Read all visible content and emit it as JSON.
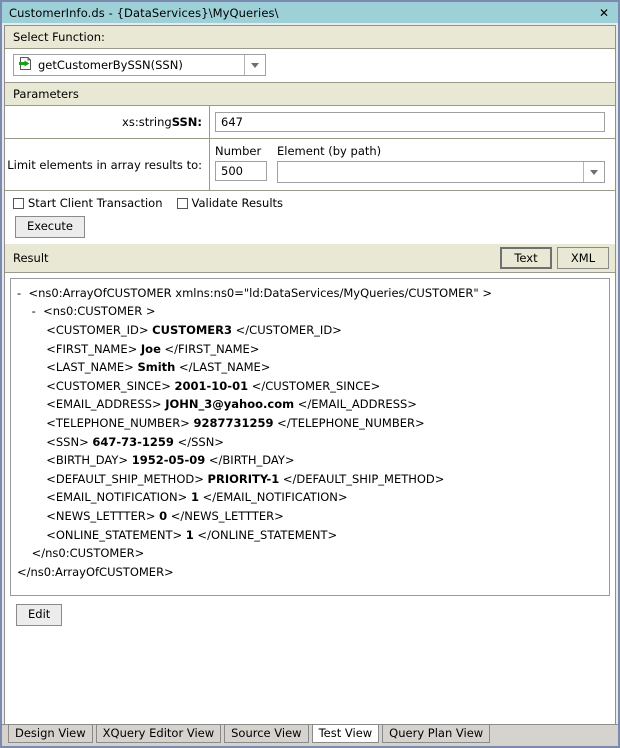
{
  "window": {
    "title": "CustomerInfo.ds - {DataServices}\\MyQueries\\",
    "close_label": "✕"
  },
  "select_function": {
    "header": "Select Function:",
    "selected": "getCustomerBySSN(SSN)",
    "icon": "function-document-arrow-icon"
  },
  "parameters": {
    "header": "Parameters",
    "ssn": {
      "type_label": "xs:string ",
      "name_label": "SSN:",
      "value": "647"
    },
    "limit": {
      "label": "Limit elements in array results to:",
      "number_header": "Number",
      "element_header": "Element (by path)",
      "number_value": "500",
      "element_value": ""
    }
  },
  "options": {
    "start_client_transaction": "Start Client Transaction",
    "validate_results": "Validate Results",
    "start_client_transaction_checked": false,
    "validate_results_checked": false
  },
  "actions": {
    "execute": "Execute",
    "edit": "Edit"
  },
  "result": {
    "header": "Result",
    "view_text": "Text",
    "view_xml": "XML",
    "active_view": "Text",
    "lines": [
      {
        "indent": 0,
        "marker": "-",
        "pre": "<ns0:ArrayOfCUSTOMER xmlns:ns0=\"ld:DataServices/MyQueries/CUSTOMER\" >",
        "value": "",
        "post": ""
      },
      {
        "indent": 1,
        "marker": "-",
        "pre": "<ns0:CUSTOMER >",
        "value": "",
        "post": ""
      },
      {
        "indent": 2,
        "marker": "",
        "pre": "<CUSTOMER_ID> ",
        "value": "CUSTOMER3",
        "post": " </CUSTOMER_ID>"
      },
      {
        "indent": 2,
        "marker": "",
        "pre": "<FIRST_NAME> ",
        "value": "Joe",
        "post": " </FIRST_NAME>"
      },
      {
        "indent": 2,
        "marker": "",
        "pre": "<LAST_NAME> ",
        "value": "Smith",
        "post": " </LAST_NAME>"
      },
      {
        "indent": 2,
        "marker": "",
        "pre": "<CUSTOMER_SINCE> ",
        "value": "2001-10-01",
        "post": " </CUSTOMER_SINCE>"
      },
      {
        "indent": 2,
        "marker": "",
        "pre": "<EMAIL_ADDRESS> ",
        "value": "JOHN_3@yahoo.com",
        "post": " </EMAIL_ADDRESS>"
      },
      {
        "indent": 2,
        "marker": "",
        "pre": "<TELEPHONE_NUMBER> ",
        "value": "9287731259",
        "post": " </TELEPHONE_NUMBER>"
      },
      {
        "indent": 2,
        "marker": "",
        "pre": "<SSN> ",
        "value": "647-73-1259",
        "post": " </SSN>"
      },
      {
        "indent": 2,
        "marker": "",
        "pre": "<BIRTH_DAY> ",
        "value": "1952-05-09",
        "post": " </BIRTH_DAY>"
      },
      {
        "indent": 2,
        "marker": "",
        "pre": "<DEFAULT_SHIP_METHOD> ",
        "value": "PRIORITY-1",
        "post": " </DEFAULT_SHIP_METHOD>"
      },
      {
        "indent": 2,
        "marker": "",
        "pre": "<EMAIL_NOTIFICATION> ",
        "value": "1",
        "post": " </EMAIL_NOTIFICATION>"
      },
      {
        "indent": 2,
        "marker": "",
        "pre": "<NEWS_LETTTER> ",
        "value": "0",
        "post": " </NEWS_LETTTER>"
      },
      {
        "indent": 2,
        "marker": "",
        "pre": "<ONLINE_STATEMENT> ",
        "value": "1",
        "post": " </ONLINE_STATEMENT>"
      },
      {
        "indent": 1,
        "marker": "",
        "pre": "</ns0:CUSTOMER>",
        "value": "",
        "post": ""
      },
      {
        "indent": 0,
        "marker": "",
        "pre": "</ns0:ArrayOfCUSTOMER>",
        "value": "",
        "post": ""
      }
    ]
  },
  "tabs": [
    {
      "label": "Design View",
      "active": false
    },
    {
      "label": "XQuery Editor View",
      "active": false
    },
    {
      "label": "Source View",
      "active": false
    },
    {
      "label": "Test View",
      "active": true
    },
    {
      "label": "Query Plan View",
      "active": false
    }
  ]
}
